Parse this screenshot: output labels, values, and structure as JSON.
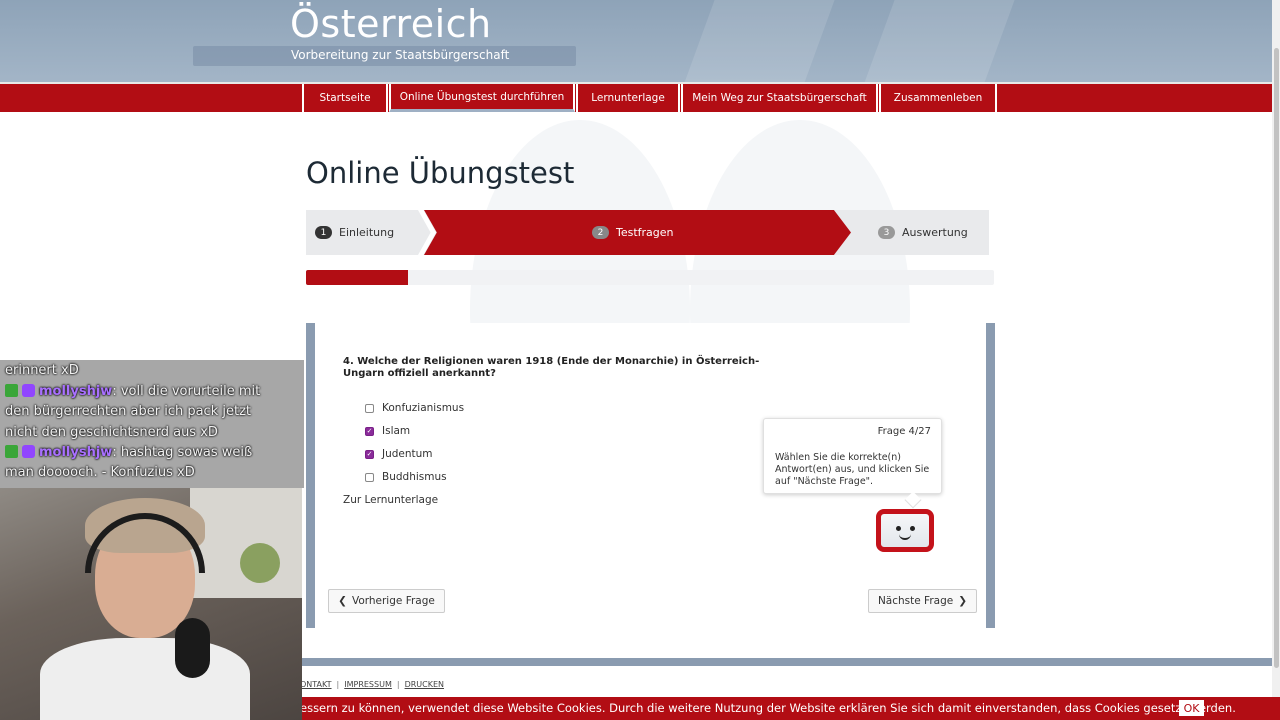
{
  "header": {
    "title": "Österreich",
    "subtitle": "Vorbereitung zur Staatsbürgerschaft"
  },
  "nav": {
    "items": [
      {
        "label": "Startseite"
      },
      {
        "label": "Online Übungstest durchführen"
      },
      {
        "label": "Lernunterlage"
      },
      {
        "label": "Mein Weg zur Staatsbürgerschaft"
      },
      {
        "label": "Zusammenleben"
      }
    ]
  },
  "page": {
    "title": "Online Übungstest"
  },
  "steps": [
    {
      "num": "1",
      "label": "Einleitung"
    },
    {
      "num": "2",
      "label": "Testfragen"
    },
    {
      "num": "3",
      "label": "Auswertung"
    }
  ],
  "progress": {
    "current": 4,
    "total": 27
  },
  "question": {
    "text": "4. Welche der Religionen waren 1918 (Ende der Monarchie) in Österreich-Ungarn offiziell anerkannt?",
    "options": [
      {
        "label": "Konfuzianismus",
        "checked": false
      },
      {
        "label": "Islam",
        "checked": true
      },
      {
        "label": "Judentum",
        "checked": true
      },
      {
        "label": "Buddhismus",
        "checked": false
      }
    ],
    "link": "Zur Lernunterlage"
  },
  "tooltip": {
    "counter": "Frage 4/27",
    "text": "Wählen Sie die korrekte(n) Antwort(en) aus, und klicken Sie auf \"Nächste Frage\"."
  },
  "buttons": {
    "prev": "Vorherige Frage",
    "next": "Nächste Frage"
  },
  "footer": {
    "links": [
      "ONTAKT",
      "IMPRESSUM",
      "DRUCKEN"
    ],
    "separator": "|"
  },
  "cookie": {
    "text": "essern zu können, verwendet diese Website Cookies. Durch die weitere Nutzung der Website erklären Sie sich damit einverstanden, dass Cookies gesetzt werden.",
    "ok": "OK"
  },
  "chat": {
    "lines": [
      {
        "user": "",
        "text": "erinnert xD"
      },
      {
        "user": "mollyshjw",
        "text": ": voll die vorurteile mit"
      },
      {
        "user": "",
        "text": "den bürgerrechten aber ich pack jetzt"
      },
      {
        "user": "",
        "text": "nicht den geschichtsnerd aus xD"
      },
      {
        "user": "mollyshjw",
        "text": ": hashtag sowas weiß"
      },
      {
        "user": "",
        "text": "man dooooch. - Konfuzius xD"
      }
    ]
  },
  "colors": {
    "brand_red": "#b20d14",
    "header_blue": "#8ea3b8",
    "frame_blue": "#8a9bb0",
    "checkbox_checked": "#8a2c9a"
  }
}
